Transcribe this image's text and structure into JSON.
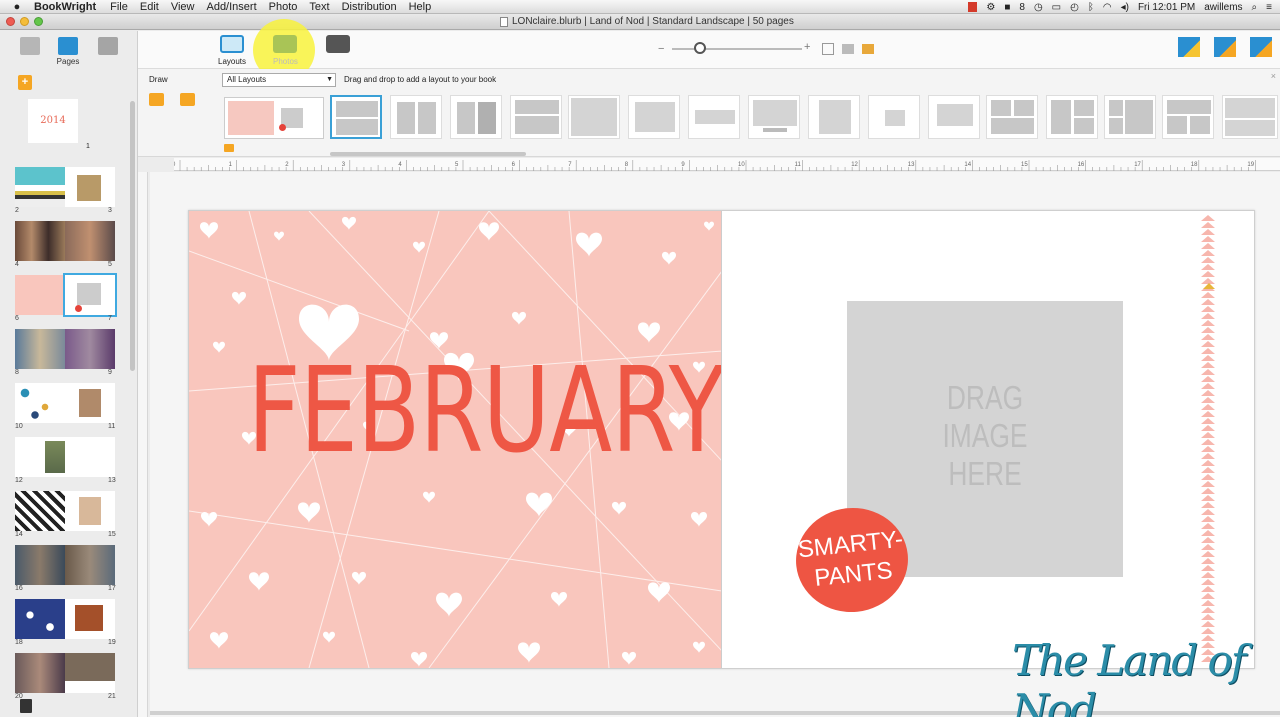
{
  "menubar": {
    "app_name": "BookWright",
    "items": [
      "File",
      "Edit",
      "View",
      "Add/Insert",
      "Photo",
      "Text",
      "Distribution",
      "Help"
    ],
    "status": {
      "count": "8",
      "clock": "Fri 12:01 PM",
      "user": "awillems"
    }
  },
  "window": {
    "title": "LONclaire.blurb | Land of Nod | Standard Landscape | 50 pages"
  },
  "sidebar": {
    "tool_pages_label": "Pages",
    "page_numbers": [
      [
        "2",
        "3"
      ],
      [
        "4",
        "5"
      ],
      [
        "6",
        "7"
      ],
      [
        "8",
        "9"
      ],
      [
        "10",
        "11"
      ],
      [
        "12",
        "13"
      ],
      [
        "14",
        "15"
      ],
      [
        "16",
        "17"
      ],
      [
        "18",
        "19"
      ],
      [
        "20",
        "21"
      ]
    ],
    "cover_label": "2014",
    "cover_number": "1"
  },
  "toolbar": {
    "layouts_label": "Layouts",
    "photos_label": "Photos"
  },
  "layouts_panel": {
    "draw_label": "Draw",
    "select_value": "All Layouts",
    "hint": "Drag and drop to add a layout to your book",
    "close": "×"
  },
  "ruler": {
    "marks": [
      "0",
      "1",
      "2",
      "3",
      "4",
      "5",
      "6",
      "7",
      "8",
      "9",
      "10",
      "11",
      "12",
      "13",
      "14",
      "15",
      "16",
      "17",
      "18",
      "19"
    ]
  },
  "spread": {
    "left_text": "FEBRUARY",
    "placeholder_text": "DRAG\nIMAGE\nHERE",
    "sticker_text": "SMARTY-\nPANTS"
  },
  "watermark": "The Land of Nod",
  "colors": {
    "accent_blue": "#3aa0d6",
    "pink_bg": "#f9c6bd",
    "coral": "#ee5745",
    "highlight": "#f8f23c"
  }
}
